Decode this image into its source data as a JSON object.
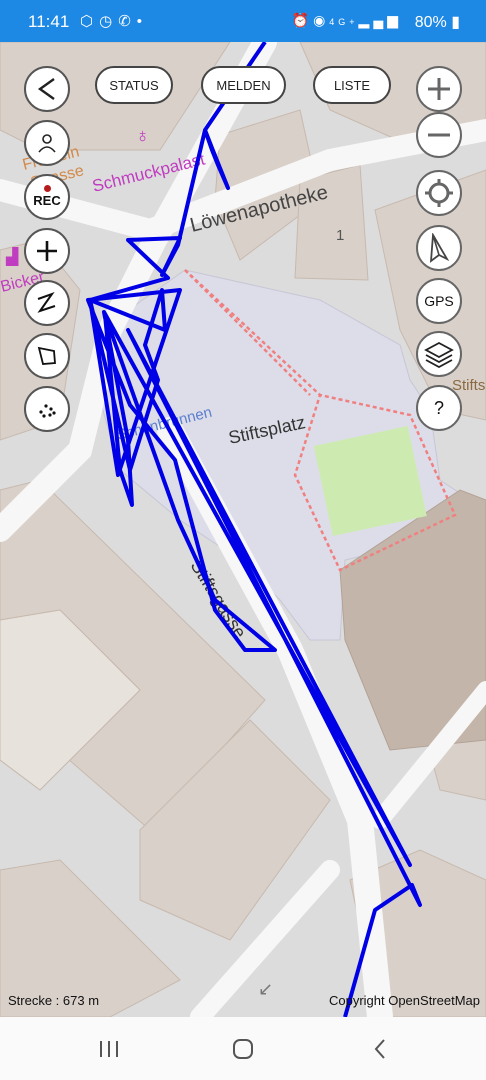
{
  "status_bar": {
    "time": "11:41",
    "left_icons": [
      "hexagon-icon",
      "telegram-icon",
      "whatsapp-icon",
      "dot-icon"
    ],
    "right_icons": [
      "alarm-icon",
      "location-icon",
      "network-4g-icon",
      "signal-icon"
    ],
    "network_label": "4G+",
    "battery_text": "80%",
    "color": "#1e88e5"
  },
  "toolbar": {
    "back_label": "<",
    "status_label": "STATUS",
    "melden_label": "MELDEN",
    "liste_label": "LISTE"
  },
  "left_buttons": {
    "rec_label": "REC"
  },
  "right_buttons": {
    "gps_label": "GPS",
    "help_label": "?"
  },
  "map": {
    "labels": {
      "loewenapotheke": "Löwenapotheke",
      "schmuckpalast": "Schmuckpalast",
      "frauleinstrasse_1": "Fräulein",
      "frauleinstrasse_2": "Strasse",
      "bicker": "Bicker",
      "stiftsplatz": "Stiftsplatz",
      "stiftsgasse": "Stiftsgasse",
      "schoenbrunnen": "Schönbrunnen",
      "stiftsmuseum": "Stiftsmuseum",
      "house_number": "1"
    },
    "track_color": "#0000e6"
  },
  "footer": {
    "distance": "Strecke : 673 m",
    "copyright": "Copyright OpenStreetMap"
  }
}
